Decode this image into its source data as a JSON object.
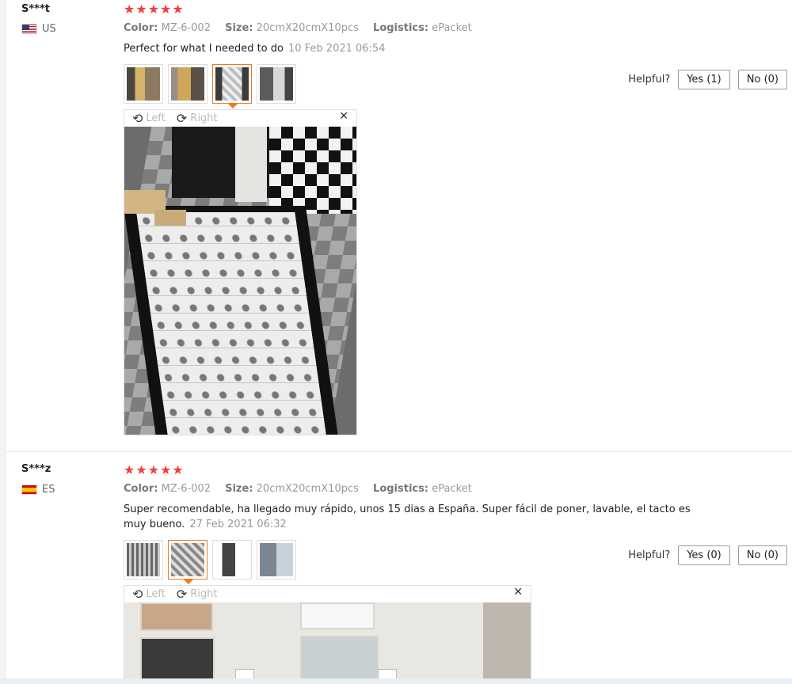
{
  "reviews": [
    {
      "user": "S***t",
      "country": "US",
      "stars": "★★★★★",
      "meta": [
        {
          "label": "Color:",
          "value": "MZ-6-002"
        },
        {
          "label": "Size:",
          "value": "20cmX20cmX10pcs"
        },
        {
          "label": "Logistics:",
          "value": "ePacket"
        }
      ],
      "text": "Perfect for what I needed to do",
      "date": "10 Feb 2021 06:54",
      "helpful": {
        "label": "Helpful?",
        "yes": "Yes (1)",
        "no": "No (0)"
      },
      "viewer": {
        "left": "Left",
        "right": "Right",
        "close": "✕"
      }
    },
    {
      "user": "S***z",
      "country": "ES",
      "stars": "★★★★★",
      "meta": [
        {
          "label": "Color:",
          "value": "MZ-6-002"
        },
        {
          "label": "Size:",
          "value": "20cmX20cmX10pcs"
        },
        {
          "label": "Logistics:",
          "value": "ePacket"
        }
      ],
      "text": "Super recomendable, ha llegado muy rápido, unos 15 dias a España. Super fácil de poner, lavable, el tacto es muy bueno.",
      "date": "27 Feb 2021 06:32",
      "helpful": {
        "label": "Helpful?",
        "yes": "Yes (0)",
        "no": "No (0)"
      },
      "viewer": {
        "left": "Left",
        "right": "Right",
        "close": "✕"
      }
    }
  ]
}
